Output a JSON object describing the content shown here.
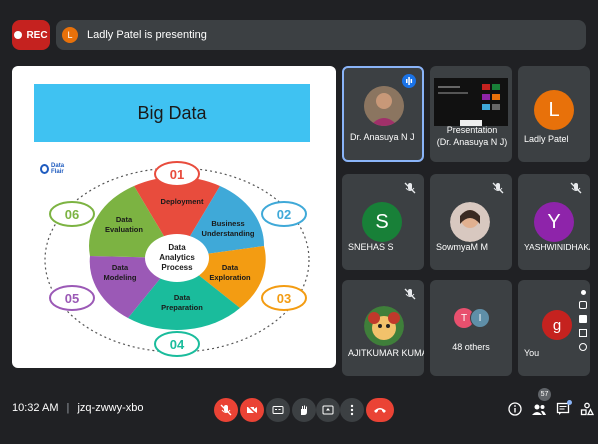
{
  "topbar": {
    "rec_label": "REC",
    "presenter_initial": "L",
    "presenting_text": "Ladly Patel is presenting"
  },
  "slide": {
    "title": "Big Data",
    "logo_text": "Data Flair",
    "center_label": "Data Analytics Process",
    "steps": [
      {
        "num": "01",
        "label": "Deployment",
        "color": "#e84c3d"
      },
      {
        "num": "02",
        "label": "Business Understanding",
        "color": "#3fa9d8"
      },
      {
        "num": "03",
        "label": "Data Exploration",
        "color": "#f39c12"
      },
      {
        "num": "04",
        "label": "Data Preparation",
        "color": "#1abc9c"
      },
      {
        "num": "05",
        "label": "Data Modeling",
        "color": "#9b59b6"
      },
      {
        "num": "06",
        "label": "Data Evaluation",
        "color": "#7cb342"
      }
    ]
  },
  "participants": [
    {
      "name": "Dr. Anasuya N J",
      "type": "photo",
      "speaking": true
    },
    {
      "name": "Presentation\n(Dr. Anasuya N J)",
      "type": "presentation"
    },
    {
      "name": "Ladly Patel",
      "type": "avatar",
      "initial": "L",
      "color": "#e8710a"
    },
    {
      "name": "SNEHAS S",
      "type": "avatar",
      "initial": "S",
      "color": "#188038"
    },
    {
      "name": "SowmyaM M",
      "type": "photo"
    },
    {
      "name": "YASHWINIDHAKAL ...",
      "type": "avatar",
      "initial": "Y",
      "color": "#8e24aa"
    },
    {
      "name": "AJITKUMAR KUMAR",
      "type": "photo"
    },
    {
      "name": "48 others",
      "type": "others",
      "initials": [
        "T",
        "I"
      ]
    },
    {
      "name": "You",
      "type": "avatar",
      "initial": "g",
      "color": "#c5221f"
    }
  ],
  "bottombar": {
    "time": "10:32 AM",
    "separator": "|",
    "meeting_code": "jzq-zwwy-xbo",
    "people_count": "57"
  },
  "colors": {
    "background": "#202124",
    "tile": "#3c4043",
    "danger": "#ea4335",
    "speaking": "#8ab4f8"
  }
}
